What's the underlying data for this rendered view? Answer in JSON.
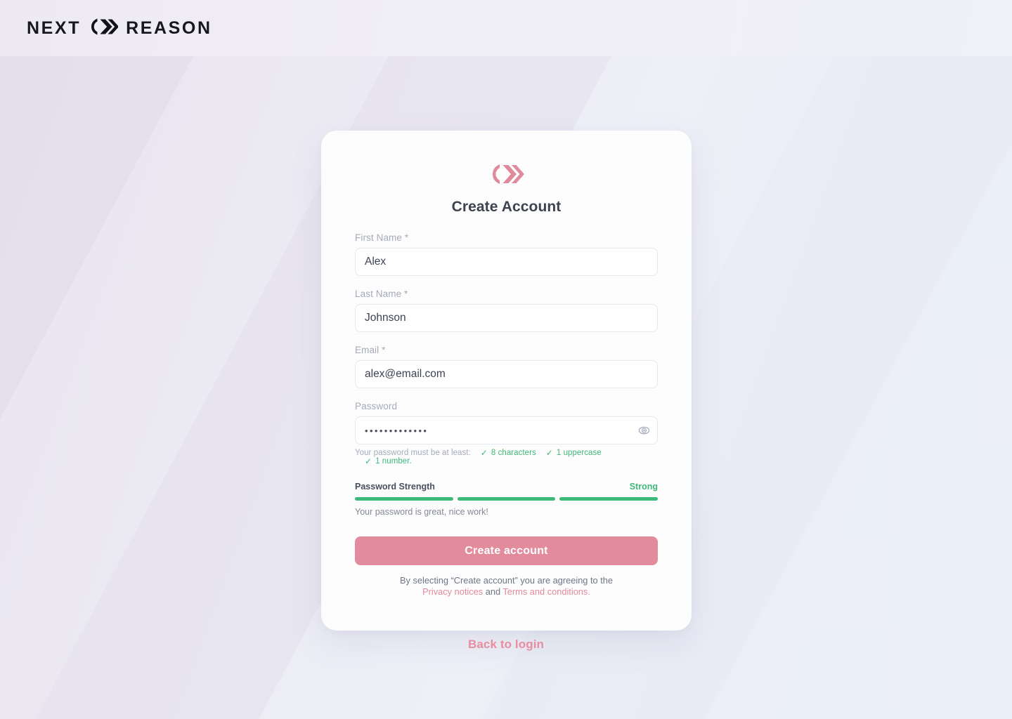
{
  "header": {
    "brand_left": "NEXT",
    "brand_right": "REASON",
    "logo_icon": "chevrons-logo-icon"
  },
  "card": {
    "logo_icon": "chevrons-logo-icon",
    "title": "Create Account",
    "fields": [
      {
        "name": "first-name",
        "label": "First Name *",
        "value": "Alex",
        "placeholder": "First Name"
      },
      {
        "name": "last-name",
        "label": "Last Name *",
        "value": "Johnson",
        "placeholder": "Last Name"
      },
      {
        "name": "email",
        "label": "Email *",
        "value": "alex@email.com",
        "placeholder": "Email"
      }
    ],
    "password": {
      "label": "Password",
      "value": "•••••••••••••",
      "placeholder": "Password",
      "toggle_icon": "eye-icon",
      "rules_prefix": "Your password must be at least:",
      "rules": [
        {
          "check": "✓",
          "text": "8 characters"
        },
        {
          "check": "✓",
          "text": "1 uppercase"
        },
        {
          "check": "✓",
          "text": "1 number."
        }
      ]
    },
    "strength": {
      "label": "Password Strength",
      "value": "Strong",
      "segments_total": 3,
      "segments_filled": 3,
      "hint": "Your password is great, nice work!",
      "color": "#3fb978"
    },
    "submit_label": "Create account",
    "terms": {
      "lead": "By selecting “Create account” you are agreeing to the",
      "privacy_link": "Privacy notices",
      "conjunction": "and",
      "terms_link": "Terms and conditions."
    }
  },
  "footer": {
    "back_to_login": "Back to login"
  },
  "colors": {
    "accent_pink": "#e28b9c",
    "link_pink": "#e88da0",
    "success_green": "#3fb978",
    "title_gray": "#3f4350",
    "label_gray": "#a6aab8"
  }
}
